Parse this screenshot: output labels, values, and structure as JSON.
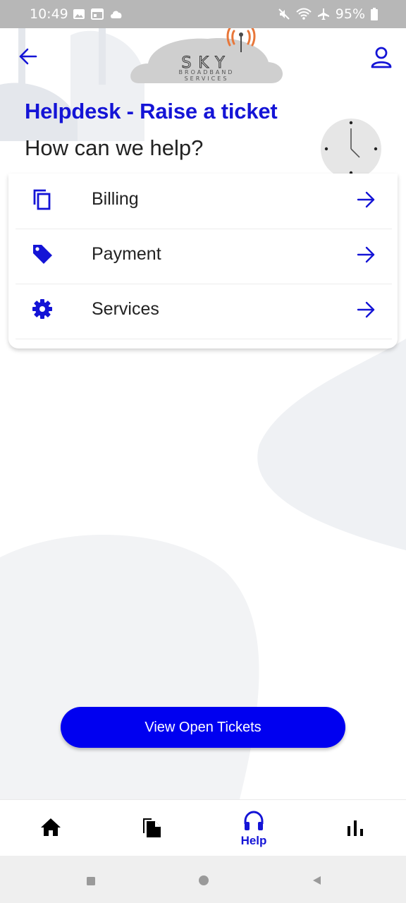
{
  "status_bar": {
    "time": "10:49",
    "left_icons": [
      "image-icon",
      "calendar-icon",
      "cloud-icon"
    ],
    "right_icons": [
      "mute-icon",
      "wifi-icon",
      "airplane-icon",
      "battery-icon"
    ],
    "battery": "95%"
  },
  "header": {
    "back_icon": "arrow-left-icon",
    "logo_text": "SKY",
    "logo_subtext_1": "BROADBAND",
    "logo_subtext_2": "SERVICES",
    "profile_icon": "person-icon"
  },
  "page": {
    "title": "Helpdesk - Raise a ticket",
    "subtitle": "How can we help?"
  },
  "categories": [
    {
      "label": "Billing",
      "icon": "copy-icon"
    },
    {
      "label": "Payment",
      "icon": "tag-icon"
    },
    {
      "label": "Services",
      "icon": "gear-icon"
    }
  ],
  "actions": {
    "view_open_tickets": "View Open Tickets"
  },
  "bottom_nav": {
    "items": [
      {
        "icon": "home-icon",
        "label": ""
      },
      {
        "icon": "document-icon",
        "label": ""
      },
      {
        "icon": "headphones-icon",
        "label": "Help",
        "active": true
      },
      {
        "icon": "bar-chart-icon",
        "label": ""
      }
    ]
  },
  "colors": {
    "brand_blue": "#1414d6",
    "button_blue": "#0000f0",
    "status_bar": "#b7b7b7",
    "logo_orange": "#e8773a"
  }
}
